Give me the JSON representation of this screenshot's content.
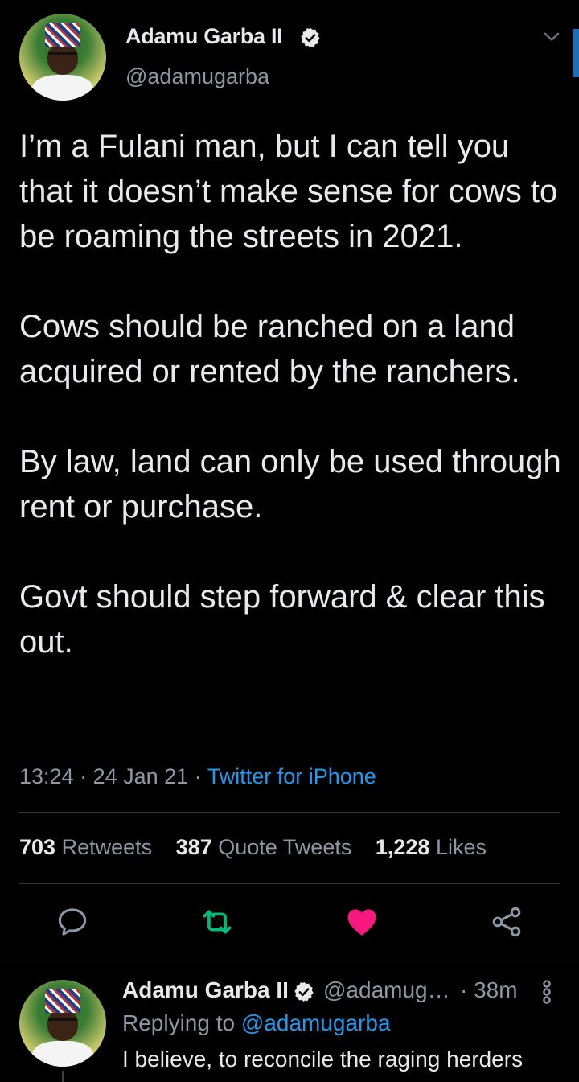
{
  "tweet": {
    "author": {
      "name": "Adamu Garba II",
      "handle": "@adamugarba",
      "verified": true
    },
    "paragraphs": [
      "I’m a Fulani man, but I can tell you that it doesn’t make sense for cows to be roaming the streets in 2021.",
      "Cows should be ranched on a land acquired or rented by the ranchers.",
      "By law, land can only be used through rent or purchase.",
      "Govt should step forward & clear this out."
    ],
    "time": "13:24",
    "separator": " · ",
    "date": "24 Jan 21",
    "source": "Twitter for iPhone",
    "stats": {
      "retweets_count": "703",
      "retweets_label": "Retweets",
      "quotes_count": "387",
      "quotes_label": "Quote Tweets",
      "likes_count": "1,228",
      "likes_label": "Likes"
    },
    "liked": true
  },
  "reply": {
    "author_name": "Adamu Garba II",
    "handle": "@adamug…",
    "time": "· 38m",
    "replying_prefix": "Replying to ",
    "replying_to": "@adamugarba",
    "text": "I believe, to reconcile the raging herders"
  },
  "colors": {
    "background": "#000000",
    "text": "#e7e9ea",
    "secondary": "#8b98a5",
    "link": "#1d9bf0",
    "retweet": "#00ba7c",
    "like": "#f91880",
    "divider": "#2f3336"
  },
  "icons": {
    "verified": "verified-badge-icon",
    "menu": "chevron-down-icon",
    "reply": "reply-icon",
    "retweet": "retweet-icon",
    "like": "heart-icon",
    "share": "share-icon",
    "more": "more-vertical-icon"
  }
}
